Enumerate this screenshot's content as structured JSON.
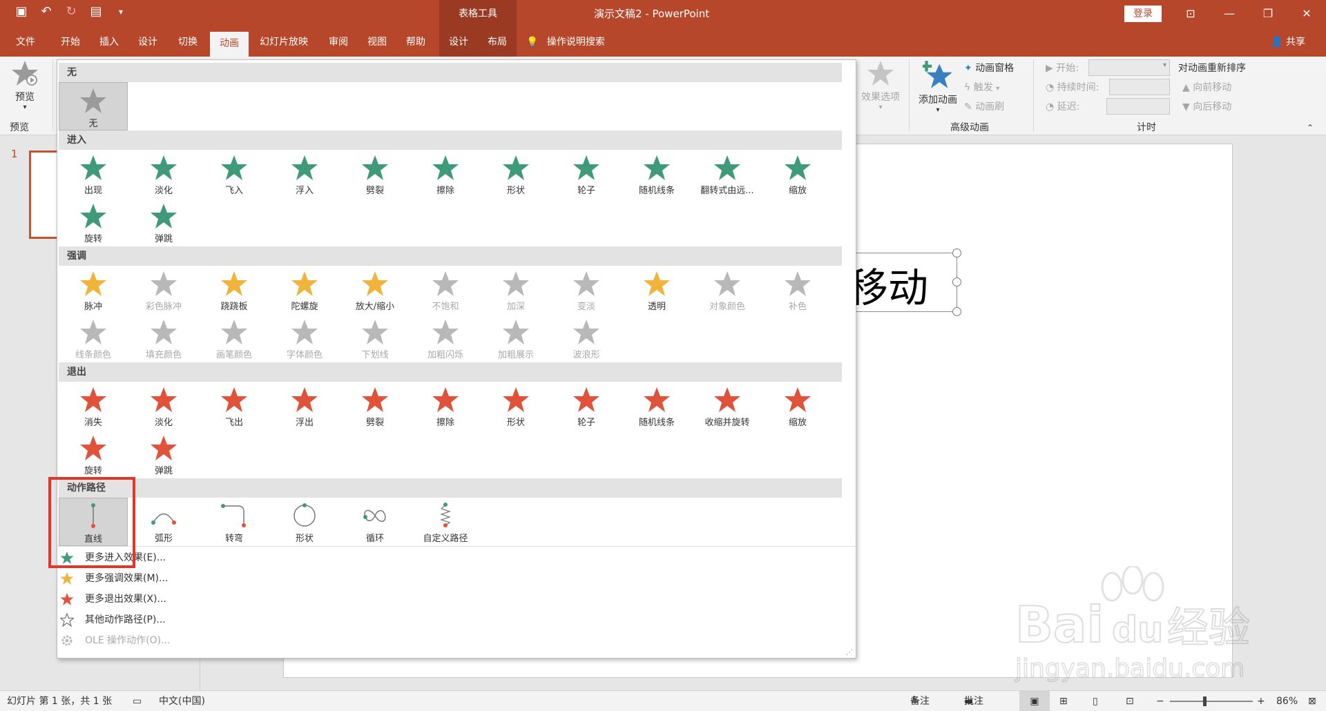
{
  "titlebar": {
    "context_tools": "表格工具",
    "doc_title": "演示文稿2  -  PowerPoint",
    "login": "登录"
  },
  "tabs": [
    "文件",
    "开始",
    "插入",
    "设计",
    "切换",
    "动画",
    "幻灯片放映",
    "审阅",
    "视图",
    "帮助",
    "设计",
    "布局"
  ],
  "active_tab": "动画",
  "search_tab": "操作说明搜索",
  "share": "共享",
  "ribbon": {
    "preview_label": "预览",
    "preview_group": "预览",
    "effect_options": "效果选项",
    "add_animation": "添加动画",
    "animation_pane": "动画窗格",
    "trigger": "触发",
    "animation_painter": "动画刷",
    "advanced_group": "高级动画",
    "start_label": "开始:",
    "duration_label": "持续时间:",
    "delay_label": "延迟:",
    "timing_group": "计时",
    "reorder_title": "对动画重新排序",
    "move_earlier": "向前移动",
    "move_later": "向后移动"
  },
  "slide": {
    "number": "1",
    "text": "移动"
  },
  "gallery": {
    "none_header": "无",
    "none_label": "无",
    "entrance_header": "进入",
    "entrance": [
      "出现",
      "淡化",
      "飞入",
      "浮入",
      "劈裂",
      "擦除",
      "形状",
      "轮子",
      "随机线条",
      "翻转式由远...",
      "缩放",
      "旋转",
      "弹跳"
    ],
    "emphasis_header": "强调",
    "emphasis": [
      "脉冲",
      "彩色脉冲",
      "跷跷板",
      "陀螺旋",
      "放大/缩小",
      "不饱和",
      "加深",
      "变淡",
      "透明",
      "对象颜色",
      "补色",
      "线条颜色",
      "填充颜色",
      "画笔颜色",
      "字体颜色",
      "下划线",
      "加粗闪烁",
      "加粗展示",
      "波浪形"
    ],
    "emphasis_disabled": [
      false,
      true,
      false,
      false,
      false,
      true,
      true,
      true,
      false,
      true,
      true,
      true,
      true,
      true,
      true,
      true,
      true,
      true,
      true
    ],
    "exit_header": "退出",
    "exit": [
      "消失",
      "淡化",
      "飞出",
      "浮出",
      "劈裂",
      "擦除",
      "形状",
      "轮子",
      "随机线条",
      "收缩并旋转",
      "缩放",
      "旋转",
      "弹跳"
    ],
    "path_header": "动作路径",
    "paths": [
      "直线",
      "弧形",
      "转弯",
      "形状",
      "循环",
      "自定义路径"
    ],
    "more": [
      "更多进入效果(E)...",
      "更多强调效果(M)...",
      "更多退出效果(X)...",
      "其他动作路径(P)...",
      "OLE 操作动作(O)..."
    ],
    "colors": {
      "entrance": "#3f9a7a",
      "emphasis": "#f0b43c",
      "exit": "#e0523a",
      "disabled": "#b8b8b8"
    }
  },
  "statusbar": {
    "slide_info": "幻灯片 第 1 张，共 1 张",
    "language": "中文(中国)",
    "notes": "备注",
    "comments": "批注",
    "zoom": "86%"
  },
  "watermark": {
    "brand": "Bai du 经验",
    "url": "jingyan.baidu.com"
  }
}
